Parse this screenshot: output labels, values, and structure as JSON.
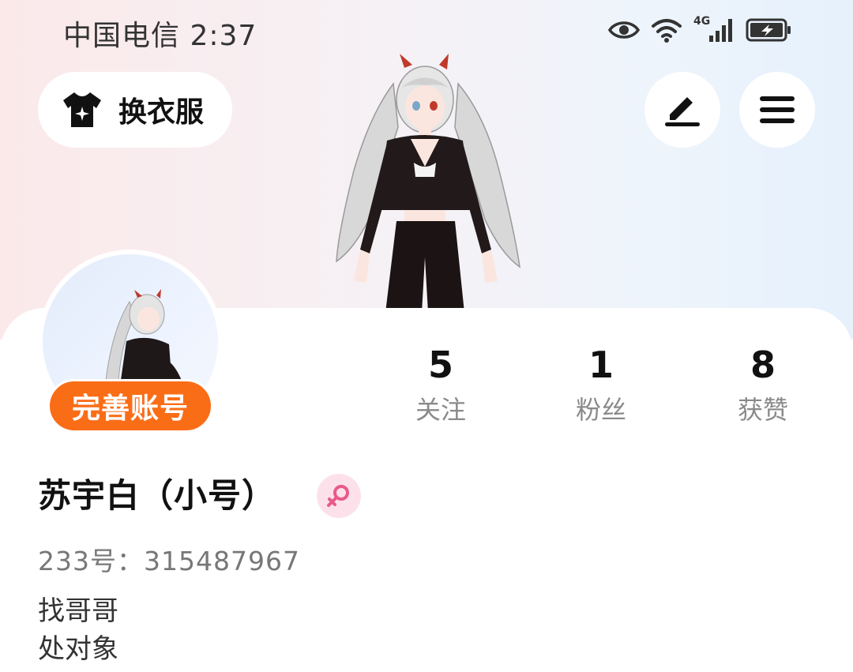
{
  "status_bar": {
    "carrier_time": "中国电信 2:37",
    "network_label": "4G",
    "icons": [
      "eye-icon",
      "wifi-icon",
      "signal-icon",
      "battery-charging-icon"
    ]
  },
  "header": {
    "outfit_button_label": "换衣服",
    "outfit_icon": "tshirt-icon",
    "edit_icon": "edit-pen-icon",
    "menu_icon": "hamburger-menu-icon"
  },
  "profile": {
    "complete_account_label": "完善账号",
    "username": "苏宇白（小号）",
    "gender_icon": "female-icon",
    "account_id": "233号：315487967",
    "bio_lines": [
      "找哥哥",
      "处对象"
    ]
  },
  "stats": [
    {
      "value": "5",
      "label": "关注"
    },
    {
      "value": "1",
      "label": "粉丝"
    },
    {
      "value": "8",
      "label": "获赞"
    }
  ],
  "colors": {
    "accent_orange": "#fa6d17",
    "gender_pink": "#e85a8a",
    "muted_text": "#8a8a8a"
  }
}
